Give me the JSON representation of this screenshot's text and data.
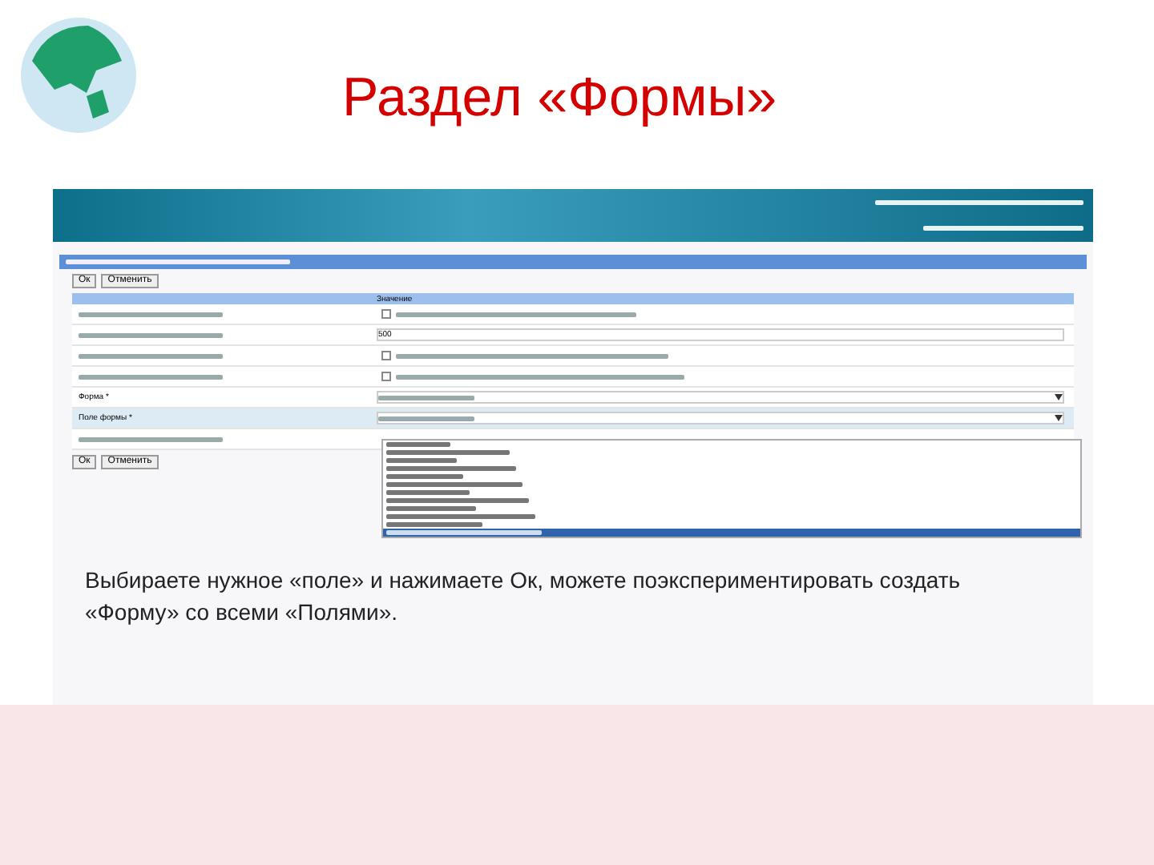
{
  "title": "Раздел «Формы»",
  "screenshot": {
    "buttons_top": [
      "Ок",
      "Отменить"
    ],
    "columns": [
      "",
      "Значение"
    ],
    "rows": [
      {
        "kind": "checkbox",
        "label": "",
        "checked": false
      },
      {
        "kind": "text",
        "label": "",
        "value": "500"
      },
      {
        "kind": "check",
        "label": "",
        "checked": false
      },
      {
        "kind": "check",
        "label": "",
        "checked": false
      },
      {
        "kind": "select",
        "label": "Форма *"
      },
      {
        "kind": "select",
        "label": "Поле формы *",
        "highlighted": true
      },
      {
        "kind": "empty",
        "label": ""
      }
    ],
    "buttons_bottom": [
      "Ок",
      "Отменить"
    ],
    "options": [
      {
        "selected": false
      },
      {
        "selected": false
      },
      {
        "selected": false
      },
      {
        "selected": false
      },
      {
        "selected": false
      },
      {
        "selected": false
      },
      {
        "selected": false
      },
      {
        "selected": false
      },
      {
        "selected": false
      },
      {
        "selected": false
      },
      {
        "selected": false
      },
      {
        "selected": true
      }
    ],
    "caption": "Выбираете нужное «поле» и нажимаете Ок, можете поэкспериментировать создать «Форму» со всеми «Полями»."
  }
}
